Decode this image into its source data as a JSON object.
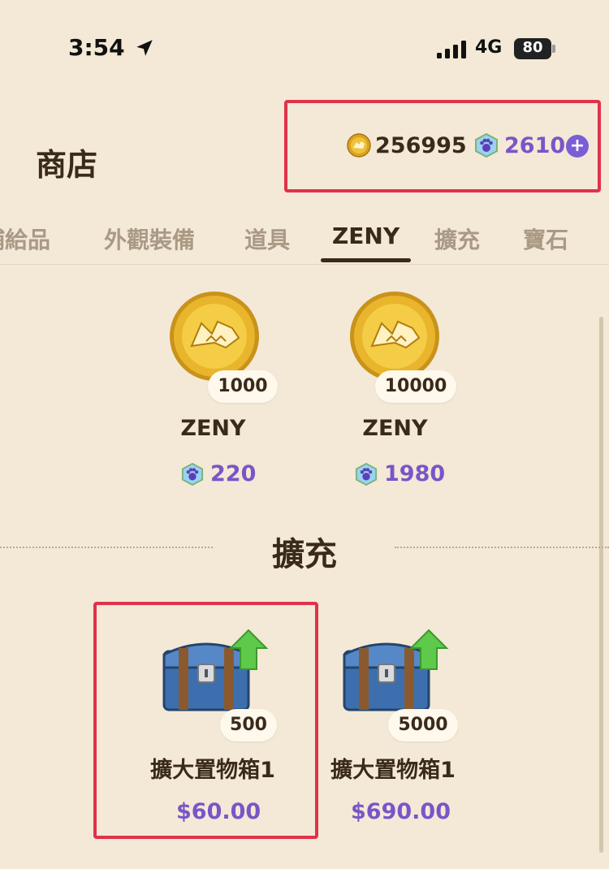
{
  "status_bar": {
    "time": "3:54",
    "network": "4G",
    "battery": "80"
  },
  "header": {
    "title": "商店",
    "zeny_balance": "256995",
    "gem_balance": "2610",
    "add_icon": "plus-icon"
  },
  "tabs": [
    {
      "label": "補給品"
    },
    {
      "label": "外觀裝備"
    },
    {
      "label": "道具"
    },
    {
      "label": "ZENY",
      "active": true
    },
    {
      "label": "擴充"
    },
    {
      "label": "寶石"
    }
  ],
  "zeny_items": [
    {
      "amount": "1000",
      "name": "ZENY",
      "price": "220"
    },
    {
      "amount": "10000",
      "name": "ZENY",
      "price": "1980"
    }
  ],
  "expansion_section": {
    "title": "擴充",
    "items": [
      {
        "amount": "500",
        "name": "擴大置物箱1",
        "price": "$60.00"
      },
      {
        "amount": "5000",
        "name": "擴大置物箱1",
        "price": "$690.00"
      }
    ]
  },
  "colors": {
    "background": "#f3e9d6",
    "accent_purple": "#7a55c8",
    "highlight_red": "#e0324a",
    "text_dark": "#3a2a1a"
  }
}
